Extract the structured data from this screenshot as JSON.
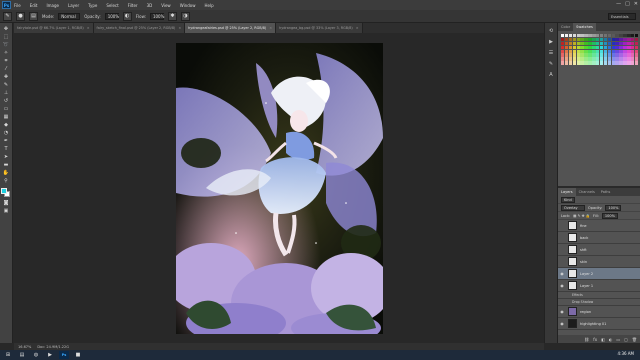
{
  "app": {
    "logo": "Ps"
  },
  "menu": [
    "File",
    "Edit",
    "Image",
    "Layer",
    "Type",
    "Select",
    "Filter",
    "3D",
    "View",
    "Window",
    "Help"
  ],
  "window_controls": [
    "—",
    "□",
    "✕"
  ],
  "options_bar": {
    "mode_label": "Mode:",
    "mode_value": "Normal",
    "opacity_label": "Opacity:",
    "opacity_value": "100%",
    "flow_label": "Flow:",
    "flow_value": "100%",
    "workspace": "Essentials"
  },
  "tabs": [
    {
      "label": "fairytale.psd @ 66.7% (Layer 1, RGB/8)",
      "active": false
    },
    {
      "label": "fairy_sketch_final.psd @ 25% (Layer 2, RGB/8)",
      "active": false
    },
    {
      "label": "hydrangeafairies.psd @ 25% (Layer 2, RGB/8)",
      "active": true
    },
    {
      "label": "hydrangea_bg.psd @ 33% (Layer 3, RGB/8)",
      "active": false
    }
  ],
  "status": {
    "zoom": "16.67%",
    "doc": "Doc: 24.9M/1.22G"
  },
  "panels": {
    "top_tabs": [
      "Color",
      "Swatches"
    ],
    "layer_tabs": [
      "Layers",
      "Channels",
      "Paths"
    ],
    "kind_label": "Kind",
    "blend_mode": "Overlay",
    "opacity_label": "Opacity:",
    "opacity_value": "100%",
    "lock_label": "Lock:",
    "fill_label": "Fill:",
    "fill_value": "100%"
  },
  "layers": [
    {
      "name": "fine",
      "selected": false,
      "thumb": "#eaeaea"
    },
    {
      "name": "back",
      "selected": false,
      "thumb": "#eaeaea"
    },
    {
      "name": "shft",
      "selected": false,
      "thumb": "#eaeaea"
    },
    {
      "name": "skin",
      "selected": false,
      "thumb": "#eaeaea"
    },
    {
      "name": "Layer 2",
      "selected": true,
      "thumb": "#eaeaea"
    },
    {
      "name": "Layer 1",
      "selected": false,
      "thumb": "#eaeaea"
    }
  ],
  "effects": {
    "label": "Effects",
    "drop_shadow": "Drop Shadow"
  },
  "layers_bottom": [
    {
      "name": "region",
      "thumb": "#7d6aa8"
    },
    {
      "name": "highlighting 01",
      "thumb": "#1c1c1c"
    },
    {
      "name": "Background",
      "thumb": "#0e110c"
    }
  ],
  "clock": "4:36 AM",
  "colors": {
    "accent": "#20d0e0",
    "selected_layer": "#6c7887",
    "ps_blue": "#39a8ff"
  }
}
